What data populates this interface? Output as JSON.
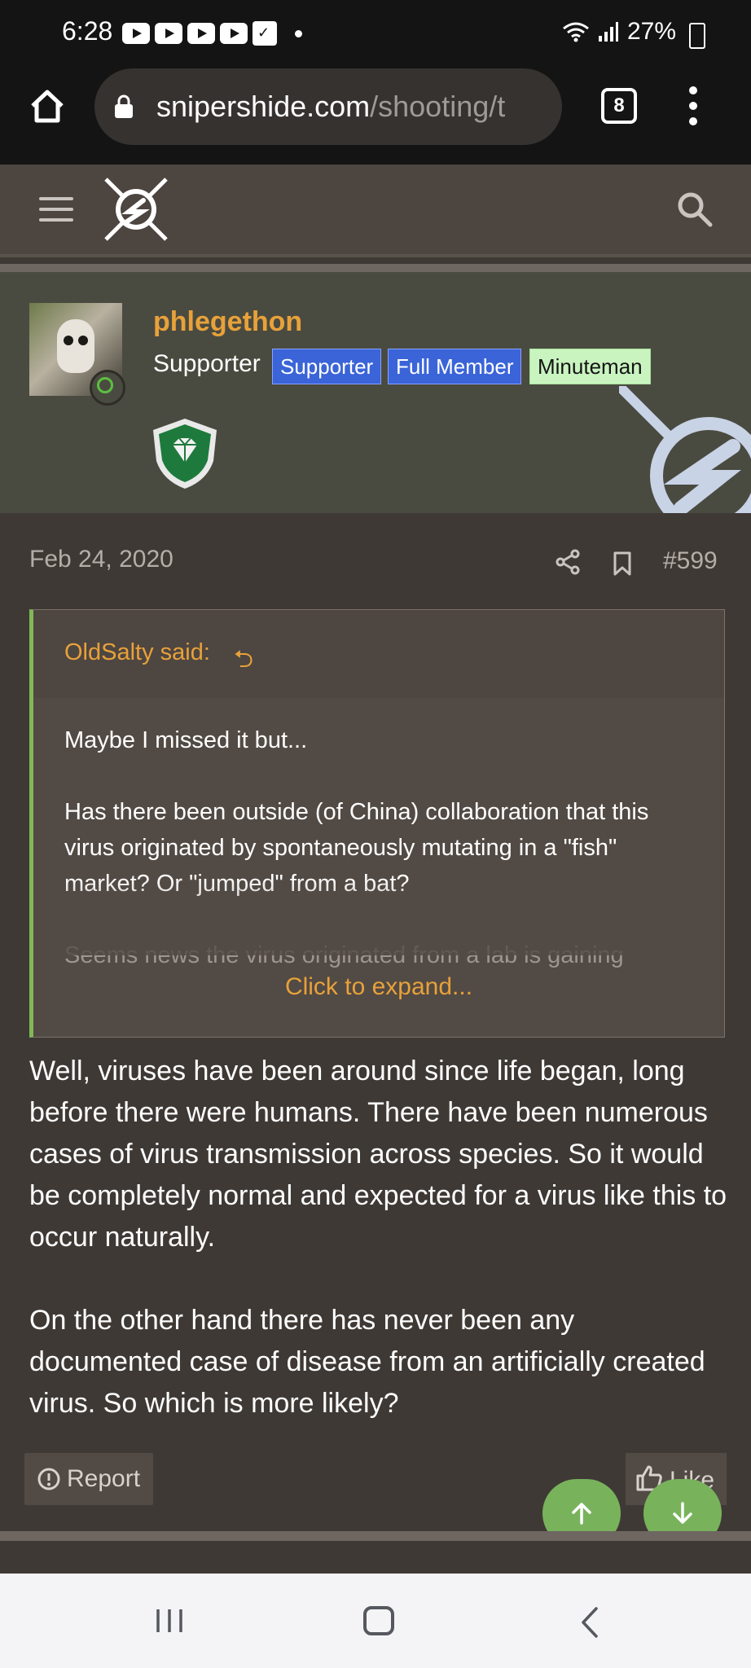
{
  "status_bar": {
    "time": "6:28",
    "battery": "27%"
  },
  "browser": {
    "url_host": "snipershide.com",
    "url_path": "/shooting/t",
    "tab_count": "8"
  },
  "user": {
    "name": "phlegethon",
    "title": "Supporter",
    "badges": [
      "Supporter",
      "Full Member",
      "Minuteman"
    ],
    "name_color": "#e8a13a"
  },
  "post": {
    "date": "Feb 24, 2020",
    "number": "#599",
    "quote": {
      "author": "OldSalty said:",
      "paragraphs": [
        "Maybe I missed it but...",
        "Has there been outside (of China) collaboration that this virus originated by spontaneously mutating in a \"fish\" market? Or \"jumped\" from a bat?"
      ],
      "faded_line": "Seems news the virus originated from a lab is gaining",
      "expand_label": "Click to expand..."
    },
    "body": [
      "Well, viruses have been around since life began, long before there were humans. There have been numerous cases of virus transmission across species. So it would be completely normal and expected for a virus like this to occur naturally.",
      "On the other hand there has never been any documented case of disease from an artificially created virus. So which is more likely?"
    ],
    "actions": {
      "report": "Report",
      "like": "Like"
    }
  },
  "colors": {
    "accent": "#e8a13a",
    "quote_bar": "#7fb957",
    "fab": "#78b35c"
  }
}
